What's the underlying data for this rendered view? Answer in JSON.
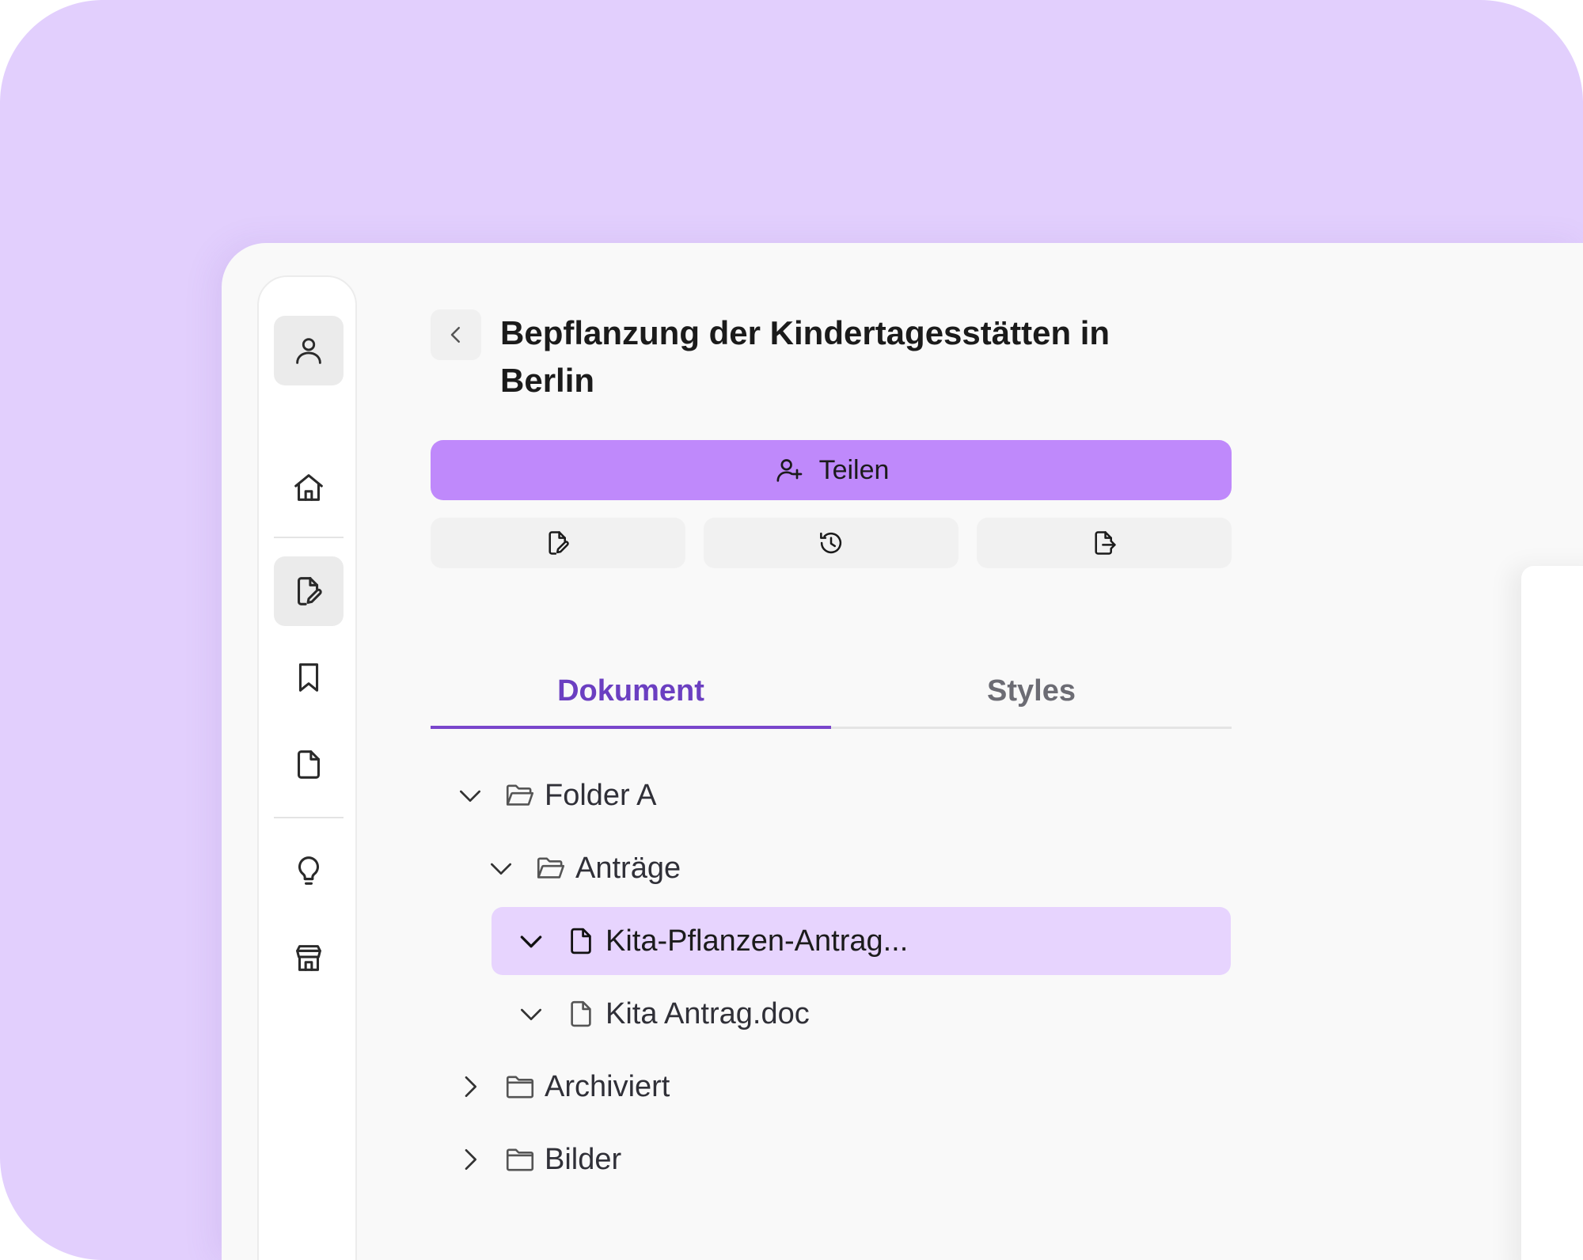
{
  "header": {
    "title": "Bepflanzung der Kindertagesstätten in Berlin"
  },
  "actions": {
    "share_label": "Teilen"
  },
  "tabs": [
    {
      "label": "Dokument",
      "active": true
    },
    {
      "label": "Styles",
      "active": false
    }
  ],
  "tree": [
    {
      "label": "Folder A",
      "expanded": true,
      "type": "folder-open"
    },
    {
      "label": "Anträge",
      "expanded": true,
      "type": "folder-open"
    },
    {
      "label": "Kita-Pflanzen-Antrag...",
      "expanded": true,
      "type": "file",
      "selected": true
    },
    {
      "label": "Kita Antrag.doc",
      "expanded": true,
      "type": "file"
    },
    {
      "label": "Archiviert",
      "expanded": false,
      "type": "folder"
    },
    {
      "label": "Bilder",
      "expanded": false,
      "type": "folder"
    }
  ],
  "colors": {
    "background": "#e2cffd",
    "accent": "#bf89fb",
    "tab_active": "#6b3fc1",
    "selected_row": "#e7d4fe"
  },
  "icons": {
    "rail": [
      "user-icon",
      "home-icon",
      "edit-document-icon",
      "bookmark-icon",
      "file-icon",
      "lightbulb-icon",
      "store-icon"
    ],
    "toolbar": [
      "edit-document-icon",
      "history-icon",
      "export-icon"
    ]
  }
}
